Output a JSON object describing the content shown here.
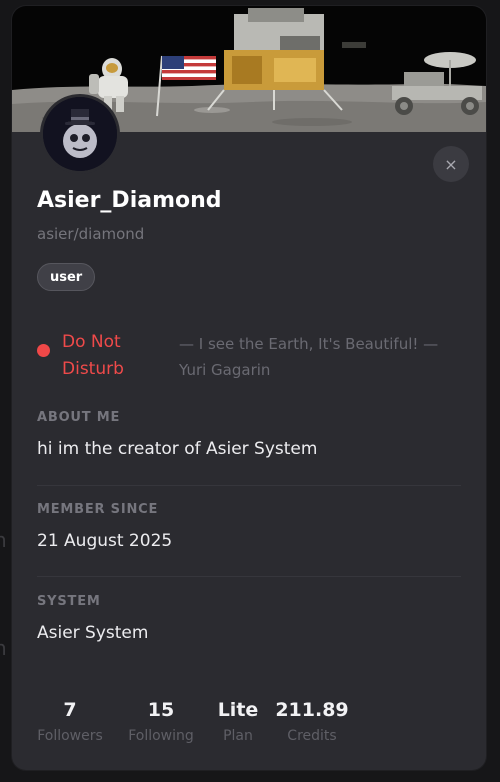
{
  "profile": {
    "username": "Asier_Diamond",
    "handle": "asier/diamond",
    "role_badge": "user",
    "close_icon": "×"
  },
  "status": {
    "label": "Do Not Disturb",
    "color": "#ef4a4a",
    "quote": "— I see the Earth, It's Beautiful! — Yuri Gagarin"
  },
  "sections": {
    "about": {
      "label": "ABOUT ME",
      "value": "hi im the creator of Asier System"
    },
    "member_since": {
      "label": "MEMBER SINCE",
      "value": "21 August 2025"
    },
    "system": {
      "label": "SYSTEM",
      "value": "Asier System"
    }
  },
  "stats": [
    {
      "value": "7",
      "label": "Followers"
    },
    {
      "value": "15",
      "label": "Following"
    },
    {
      "value": "Lite",
      "label": "Plan"
    },
    {
      "value": "211.89",
      "label": "Credits"
    }
  ],
  "background_fragments": {
    "first": "n",
    "second": "n"
  }
}
